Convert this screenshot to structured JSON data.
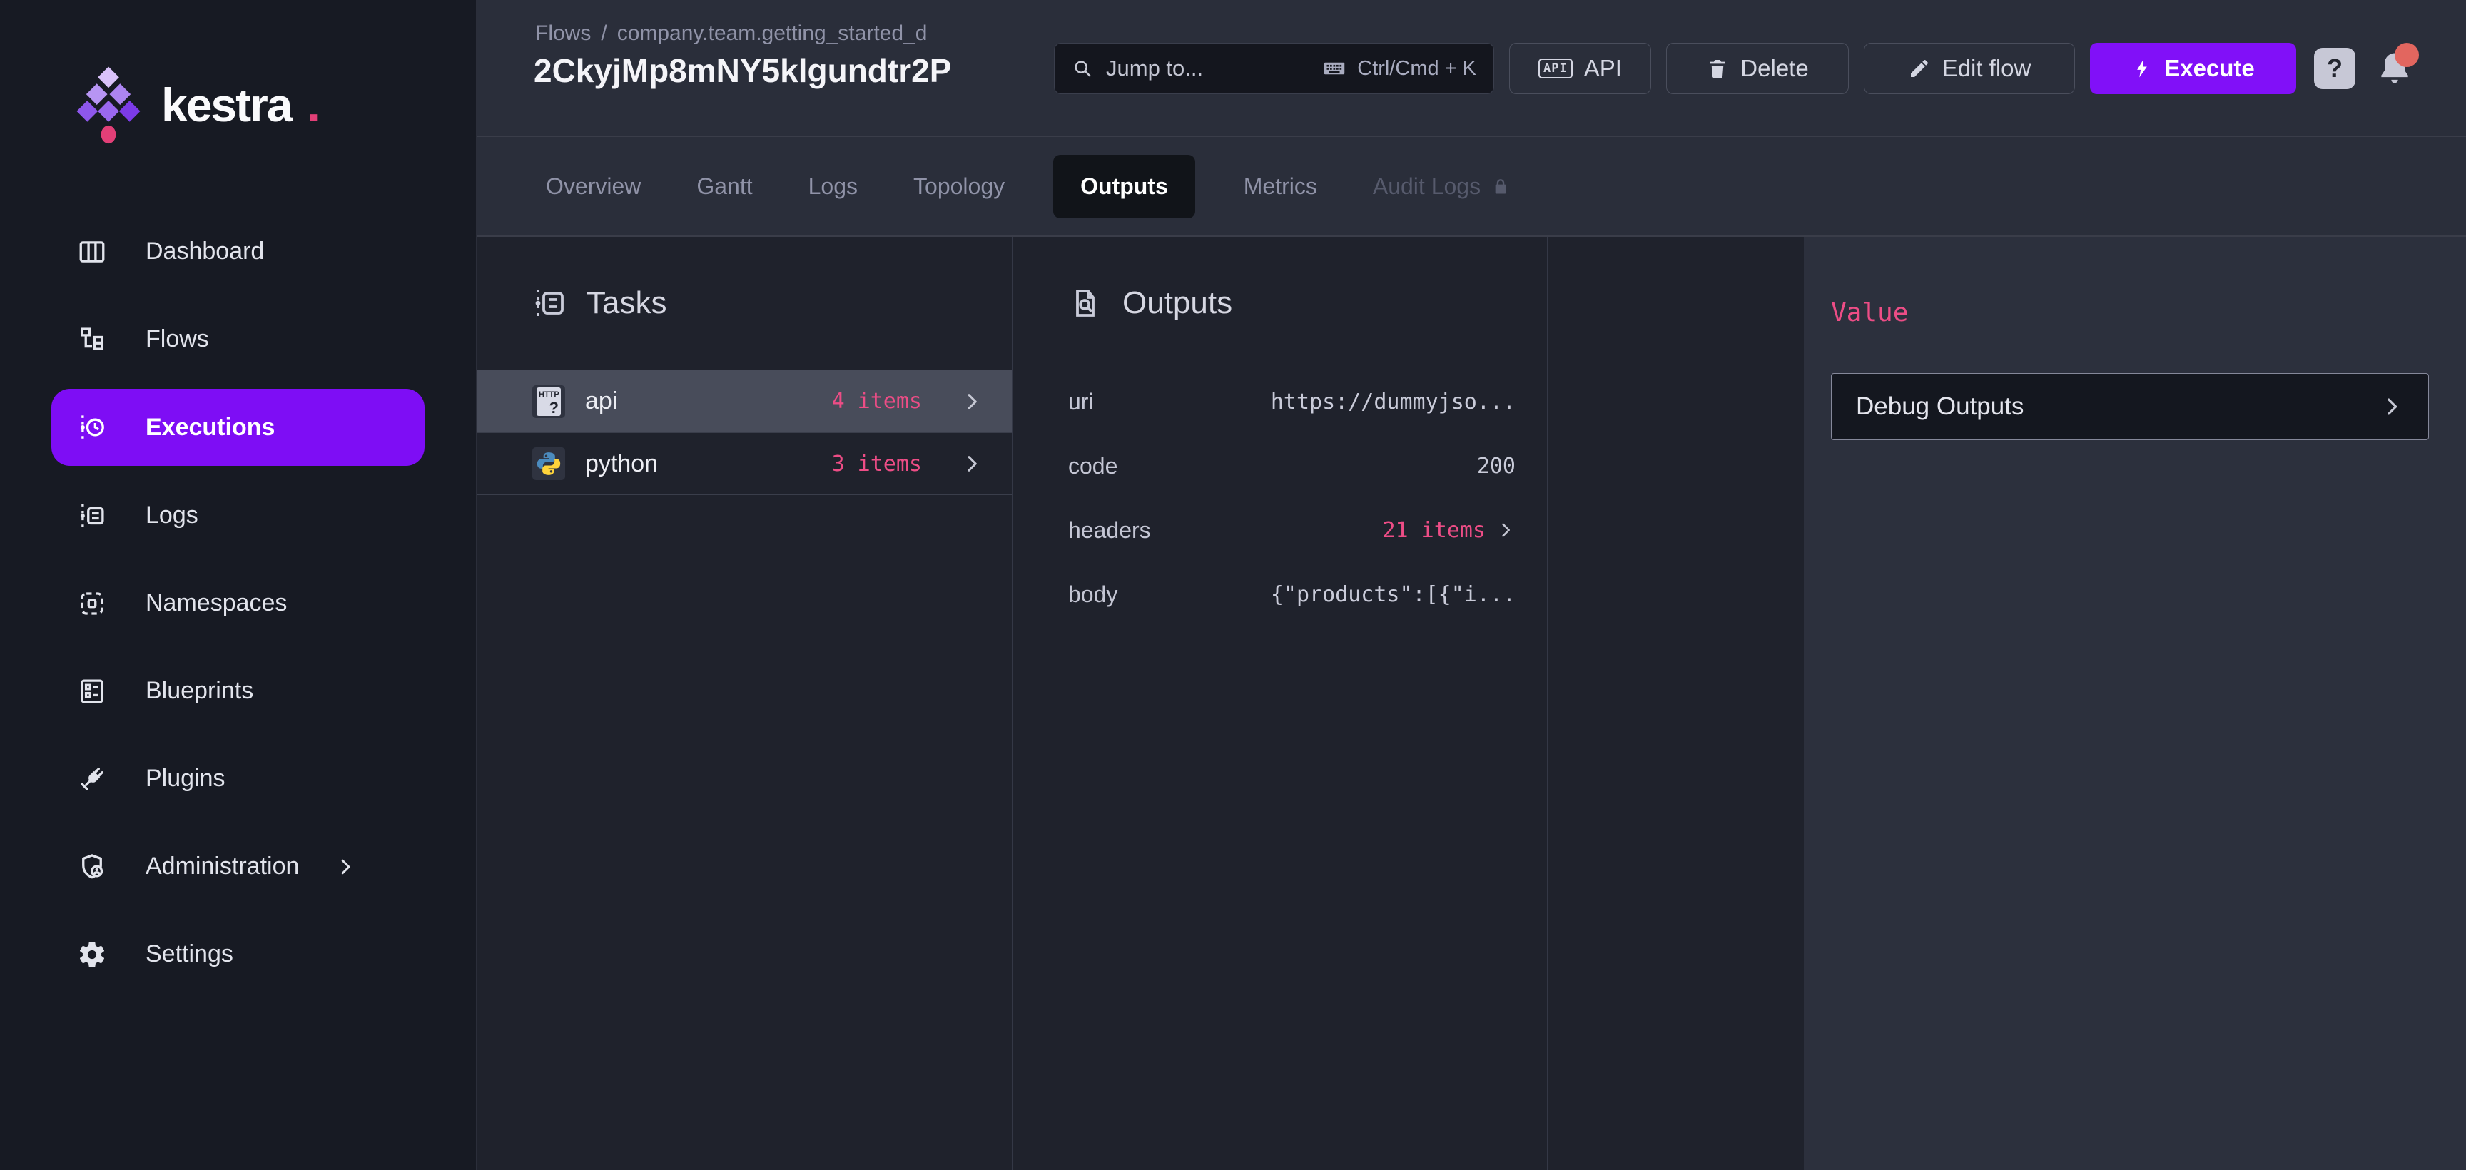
{
  "brand": {
    "name": "kestra",
    "dot": "."
  },
  "sidebar": {
    "items": [
      {
        "label": "Dashboard"
      },
      {
        "label": "Flows"
      },
      {
        "label": "Executions"
      },
      {
        "label": "Logs"
      },
      {
        "label": "Namespaces"
      },
      {
        "label": "Blueprints"
      },
      {
        "label": "Plugins"
      },
      {
        "label": "Administration"
      },
      {
        "label": "Settings"
      }
    ]
  },
  "header": {
    "breadcrumb": {
      "section": "Flows",
      "separator": "/",
      "flow": "company.team.getting_started_d"
    },
    "title": "2CkyjMp8mNY5klgundtr2P",
    "search": {
      "placeholder": "Jump to...",
      "shortcut": "Ctrl/Cmd + K"
    },
    "actions": {
      "api_badge": "API",
      "api": "API",
      "delete": "Delete",
      "edit_flow": "Edit flow",
      "execute": "Execute",
      "help": "?"
    }
  },
  "tabs": [
    {
      "label": "Overview"
    },
    {
      "label": "Gantt"
    },
    {
      "label": "Logs"
    },
    {
      "label": "Topology"
    },
    {
      "label": "Outputs",
      "active": true
    },
    {
      "label": "Metrics"
    },
    {
      "label": "Audit Logs",
      "locked": true
    }
  ],
  "tasks": {
    "title": "Tasks",
    "http_icon": {
      "label": "HTTP",
      "mark": "?"
    },
    "rows": [
      {
        "name": "api",
        "count": "4 items",
        "selected": true
      },
      {
        "name": "python",
        "count": "3 items",
        "selected": false
      }
    ]
  },
  "outputs": {
    "title": "Outputs",
    "rows": [
      {
        "key": "uri",
        "value": "https://dummyjso..."
      },
      {
        "key": "code",
        "value": "200"
      },
      {
        "key": "headers",
        "value": "21 items",
        "expandable": true
      },
      {
        "key": "body",
        "value": "{\"products\":[{\"i..."
      }
    ]
  },
  "detail": {
    "title": "Value",
    "button": "Debug Outputs"
  },
  "colors": {
    "accent_purple": "#8110F8",
    "accent_pink": "#ED4D86",
    "notification_badge": "#E2665F",
    "sidebar_bg": "#171A23",
    "topbar_bg": "#2A2E3A",
    "content_bg": "#1F222C",
    "detail_bg": "#2C303D"
  }
}
